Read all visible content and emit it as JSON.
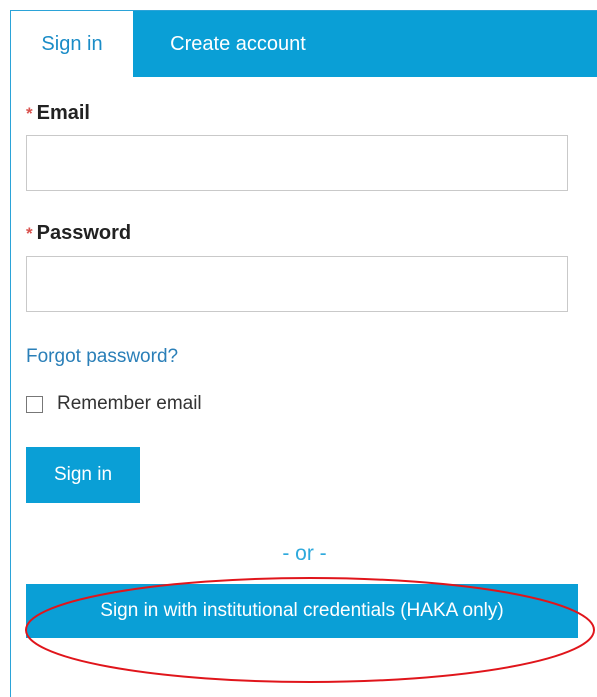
{
  "tabs": {
    "signin_label": "Sign in",
    "create_label": "Create account"
  },
  "form": {
    "required_marker": "*",
    "email_label": "Email",
    "email_value": "",
    "password_label": "Password",
    "password_value": "",
    "forgot_link": "Forgot password?",
    "remember_label": "Remember email",
    "remember_checked": false,
    "signin_button": "Sign in"
  },
  "separator": "- or -",
  "institutional_button": "Sign in with institutional credentials (HAKA only)",
  "colors": {
    "accent": "#0a9fd6",
    "link": "#2a7fb8",
    "required": "#d9534f",
    "annotation": "#e0151b"
  }
}
